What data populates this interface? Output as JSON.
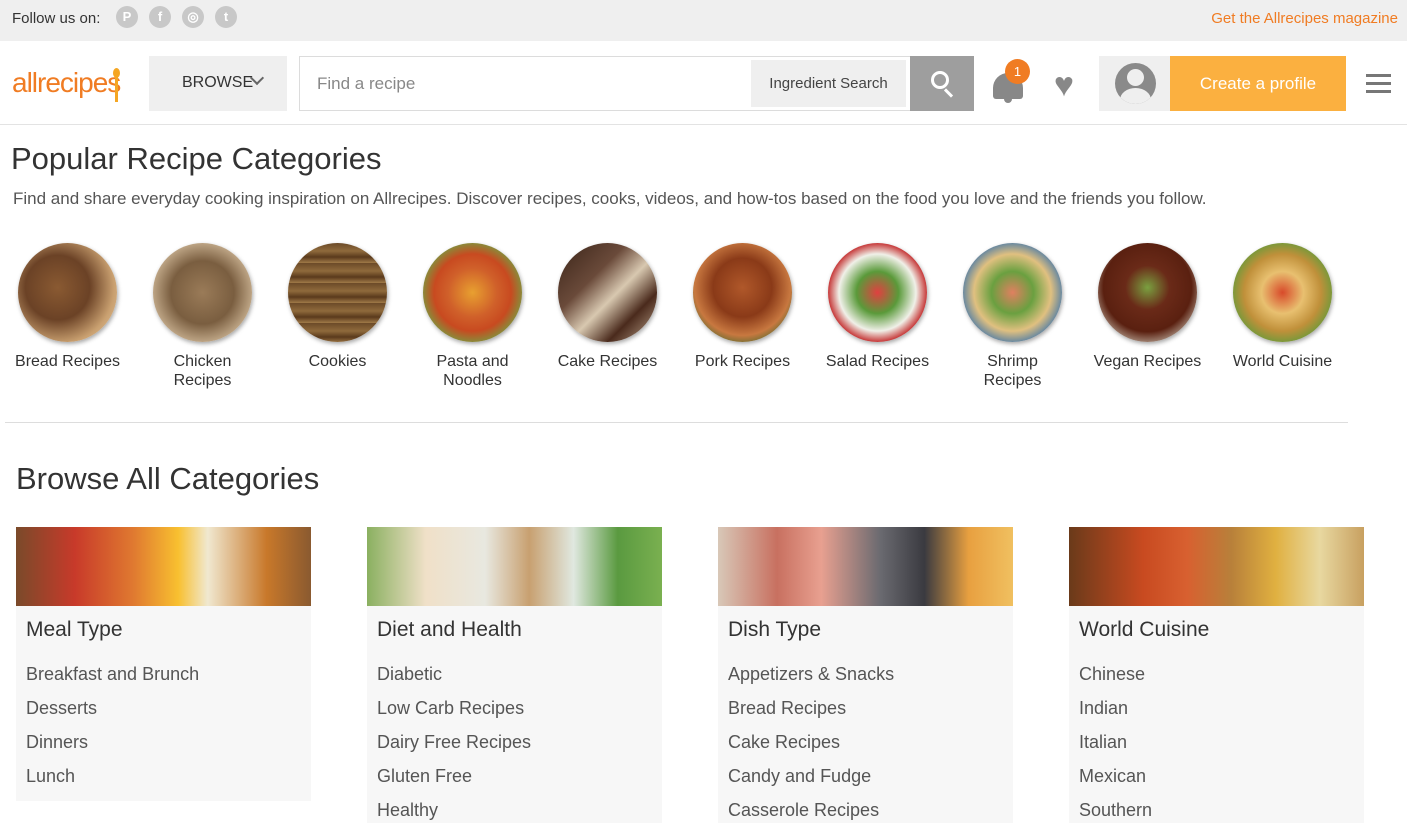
{
  "topbar": {
    "follow_label": "Follow us on:",
    "social_icons": [
      "pinterest-icon",
      "facebook-icon",
      "instagram-icon",
      "twitter-icon"
    ],
    "magazine_link": "Get the Allrecipes magazine"
  },
  "header": {
    "logo": "allrecipes",
    "browse_label": "BROWSE",
    "search_placeholder": "Find a recipe",
    "ingredient_search_label": "Ingredient Search",
    "notification_count": "1",
    "create_profile_label": "Create a profile"
  },
  "popular": {
    "title": "Popular Recipe Categories",
    "subtitle": "Find and share everyday cooking inspiration on Allrecipes. Discover recipes, cooks, videos, and how-tos based on the food you love and the friends you follow.",
    "categories": [
      {
        "line1": "Bread Recipes",
        "line2": ""
      },
      {
        "line1": "Chicken",
        "line2": "Recipes"
      },
      {
        "line1": "Cookies",
        "line2": ""
      },
      {
        "line1": "Pasta and",
        "line2": "Noodles"
      },
      {
        "line1": "Cake Recipes",
        "line2": ""
      },
      {
        "line1": "Pork Recipes",
        "line2": ""
      },
      {
        "line1": "Salad Recipes",
        "line2": ""
      },
      {
        "line1": "Shrimp",
        "line2": "Recipes"
      },
      {
        "line1": "Vegan Recipes",
        "line2": ""
      },
      {
        "line1": "World Cuisine",
        "line2": ""
      }
    ]
  },
  "browse_all": {
    "title": "Browse All Categories",
    "cards": [
      {
        "title": "Meal Type",
        "items": [
          "Breakfast and Brunch",
          "Desserts",
          "Dinners",
          "Lunch"
        ]
      },
      {
        "title": "Diet and Health",
        "items": [
          "Diabetic",
          "Low Carb Recipes",
          "Dairy Free Recipes",
          "Gluten Free",
          "Healthy"
        ]
      },
      {
        "title": "Dish Type",
        "items": [
          "Appetizers & Snacks",
          "Bread Recipes",
          "Cake Recipes",
          "Candy and Fudge",
          "Casserole Recipes"
        ]
      },
      {
        "title": "World Cuisine",
        "items": [
          "Chinese",
          "Indian",
          "Italian",
          "Mexican",
          "Southern"
        ]
      }
    ]
  },
  "colors": {
    "brand_orange": "#f07c23",
    "cta_yellow": "#fbb040"
  }
}
